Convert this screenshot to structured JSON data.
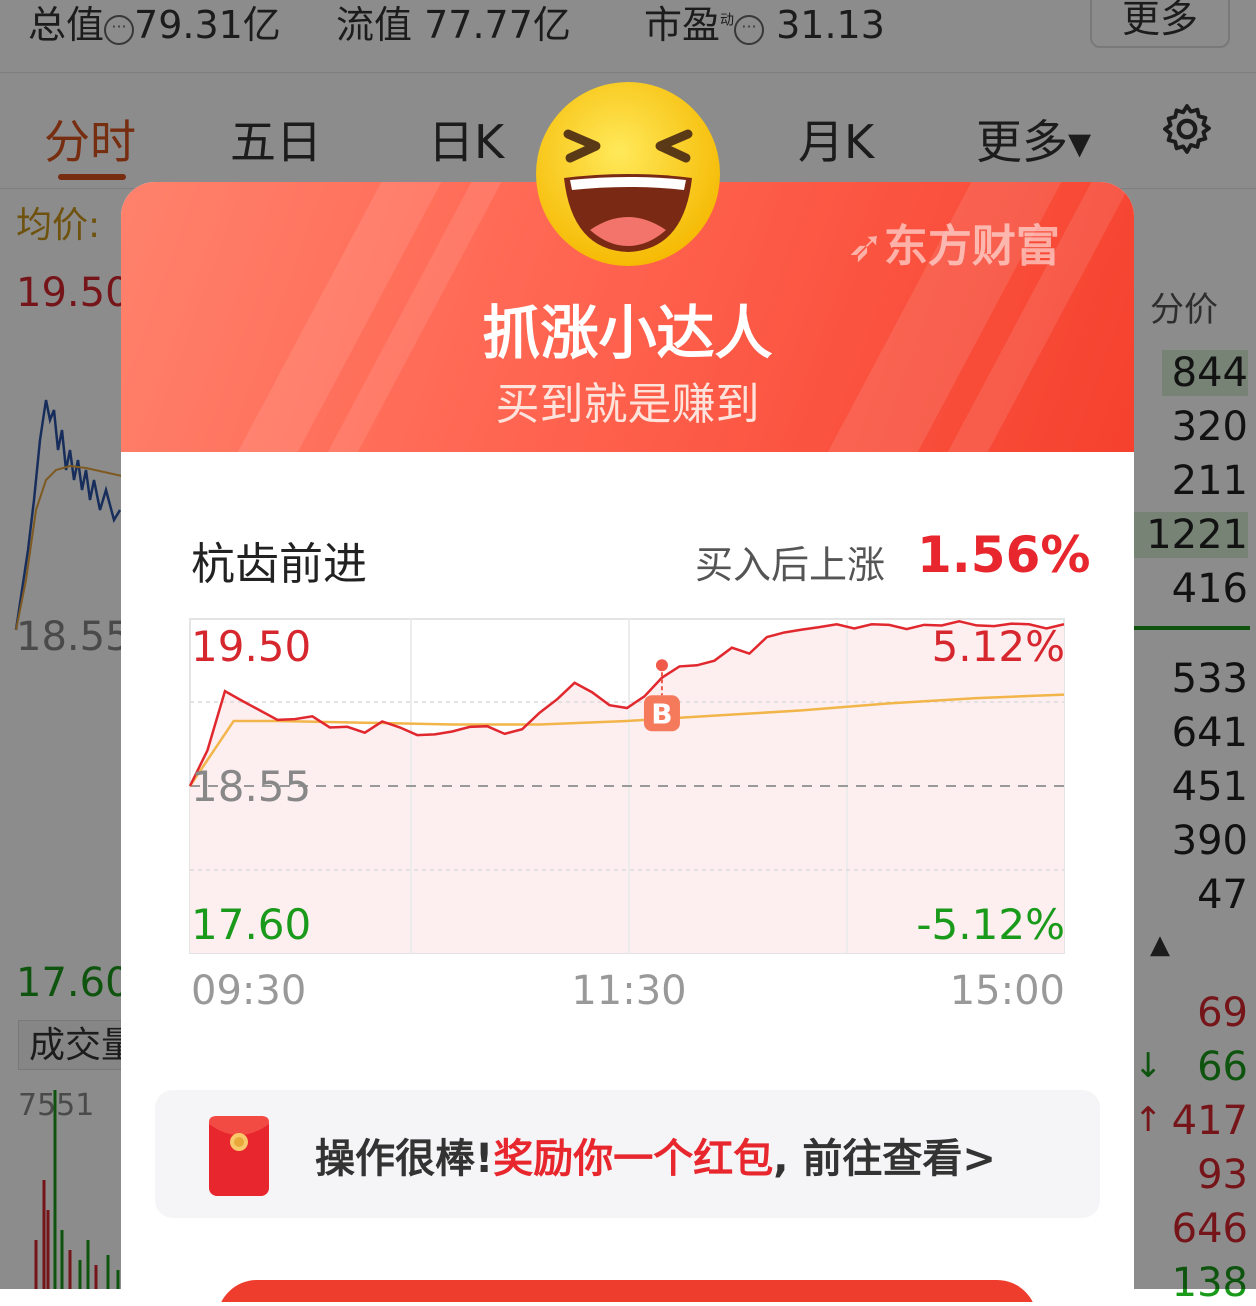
{
  "topbar": {
    "total_value_label": "总值",
    "total_value": "79.31亿",
    "float_value_label": "流值",
    "float_value": "77.77亿",
    "pe_label": "市盈",
    "pe_superscript": "动",
    "pe_value": "31.13",
    "more_button": "更多"
  },
  "tabs": [
    {
      "label": "分时",
      "active": true
    },
    {
      "label": "五日"
    },
    {
      "label": "日K"
    },
    {
      "label": "月K"
    },
    {
      "label": "更多▾"
    }
  ],
  "settings_icon": "gear-icon",
  "background_chart": {
    "avg_label": "均价:",
    "price_high": "19.50",
    "price_prev": "18.55",
    "price_low": "17.60",
    "volume_label": "成交量",
    "volume_value": "7551",
    "colors": {
      "price_line": "#2b55a8",
      "avg_line": "#e6a23c",
      "up": "#d6272e",
      "down": "#1a9a1a"
    }
  },
  "order_book": {
    "header": "分价",
    "upper": [
      "844",
      "320",
      "211",
      "1221",
      "416"
    ],
    "lower": [
      "533",
      "641",
      "451",
      "390",
      "47"
    ],
    "ticks": [
      {
        "value": "69",
        "color": "red"
      },
      {
        "value": "66",
        "color": "green",
        "arrow": "↓"
      },
      {
        "value": "417",
        "color": "red",
        "arrow": "↑"
      },
      {
        "value": "93",
        "color": "red"
      },
      {
        "value": "646",
        "color": "red"
      },
      {
        "value": "138",
        "color": "green"
      }
    ]
  },
  "dialog": {
    "brand": "东方财富",
    "title": "抓涨小达人",
    "subtitle": "买到就是赚到",
    "stock_name": "杭齿前进",
    "after_buy_label": "买入后上涨",
    "after_buy_value": "1.56%",
    "chart_data": {
      "type": "line",
      "y_high": "19.50",
      "y_mid": "18.55",
      "y_low": "17.60",
      "pct_high": "5.12%",
      "pct_low": "-5.12%",
      "x_labels": [
        "09:30",
        "11:30",
        "15:00"
      ],
      "buy_marker": "B",
      "prev_close": 18.55,
      "ylim": [
        17.6,
        19.5
      ],
      "series": [
        {
          "x": [
            0,
            2,
            4,
            6,
            8,
            10,
            12,
            14,
            16,
            18,
            20,
            22,
            24,
            26,
            28,
            30,
            32,
            34,
            36,
            38,
            40,
            42,
            44,
            46,
            48,
            50,
            52,
            54,
            56,
            58,
            60,
            62,
            64,
            66,
            68,
            70,
            72,
            74,
            76,
            78,
            80,
            82,
            84,
            86,
            88,
            90,
            92,
            94,
            96,
            98,
            100
          ],
          "values": [
            18.55,
            18.75,
            19.1,
            19.02,
            18.98,
            18.94,
            18.92,
            18.95,
            18.9,
            18.88,
            18.86,
            18.9,
            18.88,
            18.85,
            18.83,
            18.86,
            18.9,
            18.88,
            18.85,
            18.89,
            18.96,
            19.05,
            19.12,
            19.08,
            19.02,
            18.98,
            19.06,
            19.18,
            19.22,
            19.24,
            19.28,
            19.33,
            19.31,
            19.38,
            19.42,
            19.45,
            19.44,
            19.47,
            19.46,
            19.46,
            19.47,
            19.46,
            19.46,
            19.47,
            19.47,
            19.46,
            19.47,
            19.46,
            19.47,
            19.46,
            19.47
          ]
        },
        {
          "x": [
            0,
            5,
            10,
            20,
            30,
            40,
            50,
            60,
            70,
            80,
            90,
            100
          ],
          "values": [
            18.55,
            18.92,
            18.92,
            18.91,
            18.9,
            18.9,
            18.92,
            18.95,
            18.98,
            19.02,
            19.05,
            19.07
          ]
        }
      ]
    },
    "promo": {
      "icon": "red-envelope-icon",
      "text_prefix": "操作很棒!",
      "text_highlight": "奖励你一个红包",
      "text_suffix": ", 前往查看>"
    },
    "emoji_icon": "laughing-face-icon"
  }
}
